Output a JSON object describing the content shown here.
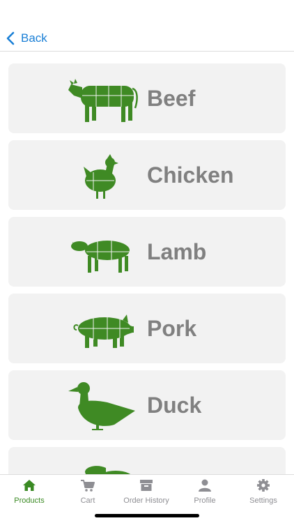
{
  "nav": {
    "back_label": "Back",
    "accent": "#1a7fd6"
  },
  "categories": [
    {
      "label": "Beef",
      "icon": "cow-icon"
    },
    {
      "label": "Chicken",
      "icon": "chicken-icon"
    },
    {
      "label": "Lamb",
      "icon": "lamb-icon"
    },
    {
      "label": "Pork",
      "icon": "pig-icon"
    },
    {
      "label": "Duck",
      "icon": "duck-icon"
    },
    {
      "label": "",
      "icon": "rabbit-icon"
    }
  ],
  "tabbar": {
    "active": "Products",
    "active_color": "#3a8a23",
    "tabs": [
      {
        "label": "Products",
        "icon": "home-icon"
      },
      {
        "label": "Cart",
        "icon": "cart-icon"
      },
      {
        "label": "Order History",
        "icon": "archive-box-icon"
      },
      {
        "label": "Profile",
        "icon": "person-icon"
      },
      {
        "label": "Settings",
        "icon": "gear-icon"
      }
    ]
  },
  "colors": {
    "icon_green": "#3f8a24",
    "card_bg": "#f2f2f2",
    "label_gray": "#808080"
  }
}
